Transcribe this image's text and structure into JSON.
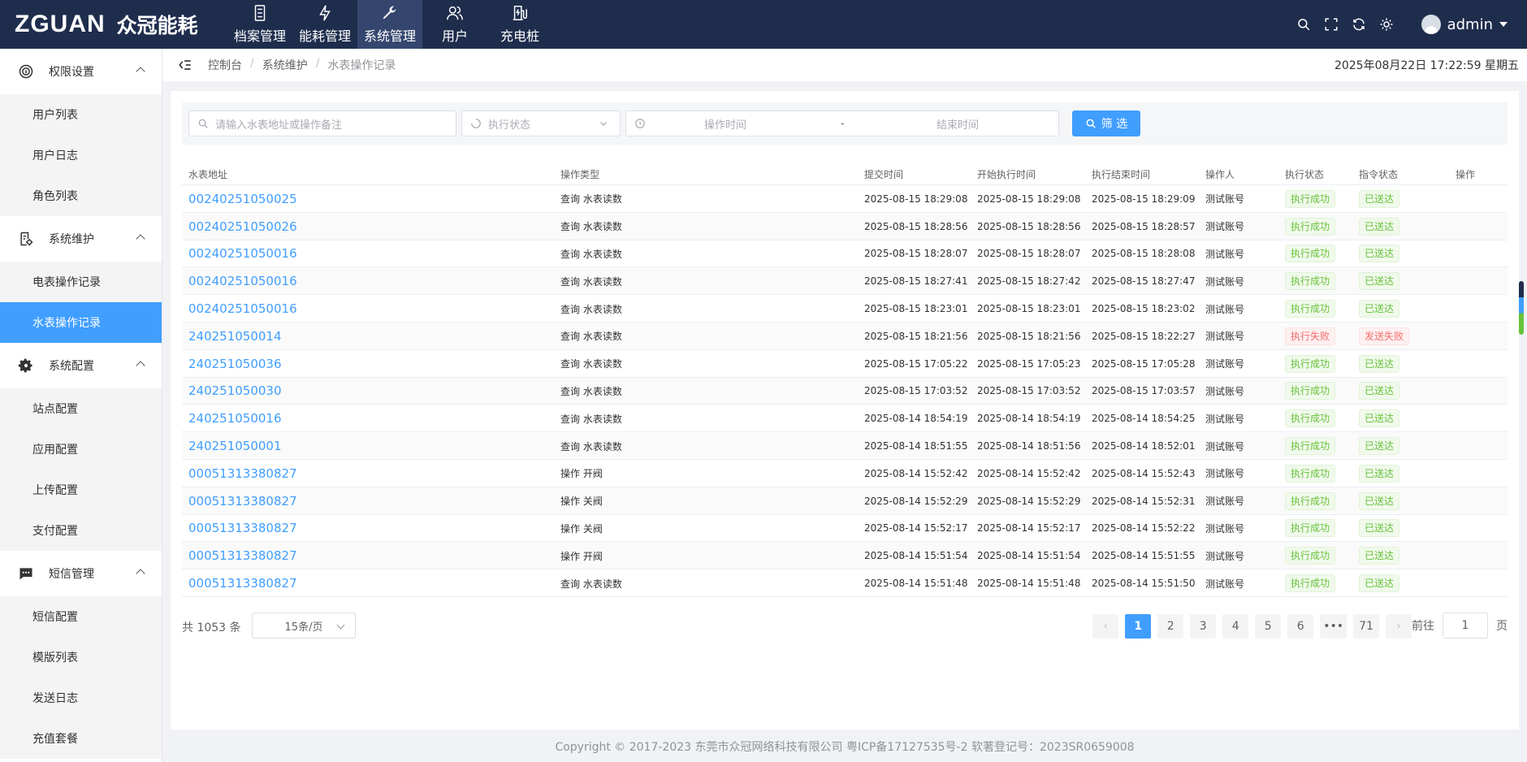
{
  "brand": {
    "en": "ZGUAN",
    "cn": "众冠能耗"
  },
  "topnav": [
    {
      "label": "档案管理",
      "icon": "archive-icon"
    },
    {
      "label": "能耗管理",
      "icon": "lightning-icon"
    },
    {
      "label": "系统管理",
      "icon": "wrench-icon"
    },
    {
      "label": "用户",
      "icon": "users-icon"
    },
    {
      "label": "充电桩",
      "icon": "charger-icon"
    }
  ],
  "user": {
    "name": "admin"
  },
  "sidebar": {
    "perm": "权限设置",
    "perm_items": [
      "用户列表",
      "用户日志",
      "角色列表"
    ],
    "maint": "系统维护",
    "maint_items": [
      "电表操作记录",
      "水表操作记录"
    ],
    "config": "系统配置",
    "config_items": [
      "站点配置",
      "应用配置",
      "上传配置",
      "支付配置"
    ],
    "sms": "短信管理",
    "sms_items": [
      "短信配置",
      "模版列表",
      "发送日志",
      "充值套餐"
    ]
  },
  "breadcrumb": [
    "控制台",
    "系统维护",
    "水表操作记录"
  ],
  "datetime": "2025年08月22日 17:22:59 星期五",
  "filter": {
    "search_placeholder": "请输入水表地址或操作备注",
    "status_placeholder": "执行状态",
    "start_placeholder": "操作时间",
    "range_sep": "-",
    "end_placeholder": "结束时间",
    "button": "筛 选"
  },
  "table": {
    "headers": [
      "水表地址",
      "操作类型",
      "提交时间",
      "开始执行时间",
      "执行结束时间",
      "操作人",
      "执行状态",
      "指令状态",
      "操作"
    ],
    "rows": [
      [
        "00240251050025",
        "查询 水表读数",
        "2025-08-15 18:29:08",
        "2025-08-15 18:29:08",
        "2025-08-15 18:29:09",
        "测试账号",
        "执行成功",
        "已送达"
      ],
      [
        "00240251050026",
        "查询 水表读数",
        "2025-08-15 18:28:56",
        "2025-08-15 18:28:56",
        "2025-08-15 18:28:57",
        "测试账号",
        "执行成功",
        "已送达"
      ],
      [
        "00240251050016",
        "查询 水表读数",
        "2025-08-15 18:28:07",
        "2025-08-15 18:28:07",
        "2025-08-15 18:28:08",
        "测试账号",
        "执行成功",
        "已送达"
      ],
      [
        "00240251050016",
        "查询 水表读数",
        "2025-08-15 18:27:41",
        "2025-08-15 18:27:42",
        "2025-08-15 18:27:47",
        "测试账号",
        "执行成功",
        "已送达"
      ],
      [
        "00240251050016",
        "查询 水表读数",
        "2025-08-15 18:23:01",
        "2025-08-15 18:23:01",
        "2025-08-15 18:23:02",
        "测试账号",
        "执行成功",
        "已送达"
      ],
      [
        "240251050014",
        "查询 水表读数",
        "2025-08-15 18:21:56",
        "2025-08-15 18:21:56",
        "2025-08-15 18:22:27",
        "测试账号",
        "执行失败",
        "发送失败"
      ],
      [
        "240251050036",
        "查询 水表读数",
        "2025-08-15 17:05:22",
        "2025-08-15 17:05:23",
        "2025-08-15 17:05:28",
        "测试账号",
        "执行成功",
        "已送达"
      ],
      [
        "240251050030",
        "查询 水表读数",
        "2025-08-15 17:03:52",
        "2025-08-15 17:03:52",
        "2025-08-15 17:03:57",
        "测试账号",
        "执行成功",
        "已送达"
      ],
      [
        "240251050016",
        "查询 水表读数",
        "2025-08-14 18:54:19",
        "2025-08-14 18:54:19",
        "2025-08-14 18:54:25",
        "测试账号",
        "执行成功",
        "已送达"
      ],
      [
        "240251050001",
        "查询 水表读数",
        "2025-08-14 18:51:55",
        "2025-08-14 18:51:56",
        "2025-08-14 18:52:01",
        "测试账号",
        "执行成功",
        "已送达"
      ],
      [
        "00051313380827",
        "操作 开阀",
        "2025-08-14 15:52:42",
        "2025-08-14 15:52:42",
        "2025-08-14 15:52:43",
        "测试账号",
        "执行成功",
        "已送达"
      ],
      [
        "00051313380827",
        "操作 关阀",
        "2025-08-14 15:52:29",
        "2025-08-14 15:52:29",
        "2025-08-14 15:52:31",
        "测试账号",
        "执行成功",
        "已送达"
      ],
      [
        "00051313380827",
        "操作 关阀",
        "2025-08-14 15:52:17",
        "2025-08-14 15:52:17",
        "2025-08-14 15:52:22",
        "测试账号",
        "执行成功",
        "已送达"
      ],
      [
        "00051313380827",
        "操作 开阀",
        "2025-08-14 15:51:54",
        "2025-08-14 15:51:54",
        "2025-08-14 15:51:55",
        "测试账号",
        "执行成功",
        "已送达"
      ],
      [
        "00051313380827",
        "查询 水表读数",
        "2025-08-14 15:51:48",
        "2025-08-14 15:51:48",
        "2025-08-14 15:51:50",
        "测试账号",
        "执行成功",
        "已送达"
      ]
    ]
  },
  "pagination": {
    "total": "共 1053 条",
    "page_size": "15条/页",
    "pages": [
      "1",
      "2",
      "3",
      "4",
      "5",
      "6",
      "•••",
      "71"
    ],
    "current": "1",
    "goto_label": "前往",
    "goto_value": "1",
    "goto_suffix": "页"
  },
  "footer": "Copyright © 2017-2023 东莞市众冠网络科技有限公司 粤ICP备17127535号-2 软著登记号：2023SR0659008",
  "colors": {
    "primary": "#409eff",
    "topbar": "#1f2d4d",
    "success": "#67c23a",
    "danger": "#f56c6c"
  }
}
